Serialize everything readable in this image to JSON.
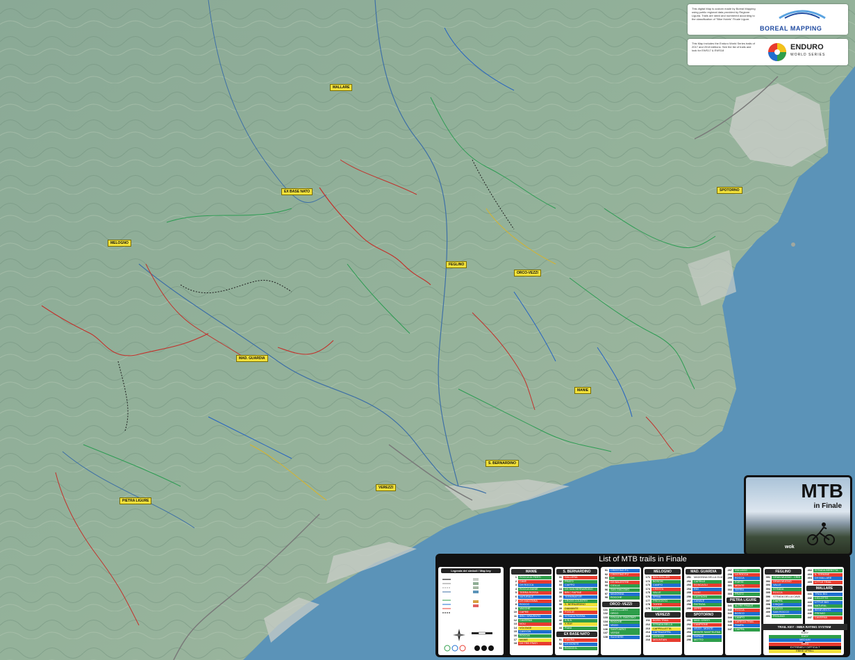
{
  "map": {
    "sea_color": "#5b93b8",
    "land_color": "#8fae95",
    "locations": [
      {
        "name": "MALLARE"
      },
      {
        "name": "EX BASE NATO"
      },
      {
        "name": "SPOTORNO"
      },
      {
        "name": "MELOGNO"
      },
      {
        "name": "FEGLINO"
      },
      {
        "name": "ORCO-VEZZI"
      },
      {
        "name": "MAD. GUARDIA"
      },
      {
        "name": "MANIE"
      },
      {
        "name": "S. BERNARDINO"
      },
      {
        "name": "VEREZZI"
      },
      {
        "name": "PIETRA LIGURE"
      }
    ]
  },
  "info_boreal": {
    "text": "This digital Map is custom made by Boreal Mapping using public regional data provided by Regione Liguria. Trails are rated and numbered according to the classification of \"Bike Hotels\" Finale Ligure.",
    "brand": "BOREAL MAPPING"
  },
  "info_ews": {
    "text": "This Map includes the Enduro World Series trails of 2017 and 2018 editions. See the list of trails and look for EWS17 & EWS18",
    "brand": "ENDURO",
    "brand_sub": "WORLD SERIES"
  },
  "photo": {
    "title": "MTB",
    "subtitle": "in Finale",
    "credit": "wok"
  },
  "list": {
    "title": "List of MTB trails in Finale",
    "legend_title": "Legenda dei simboli / Map key",
    "columns": [
      {
        "header": "MANIE",
        "rows": [
          {
            "n": "1",
            "name": "ROCCA DI PERTI",
            "c": "#2e9e4a"
          },
          {
            "n": "2",
            "name": "CAVE",
            "c": "#e83b2f"
          },
          {
            "n": "3",
            "name": "DH ROCCA",
            "c": "#1f6fd0"
          },
          {
            "n": "4",
            "name": "ROCCA MANIE",
            "c": "#2e9e4a"
          },
          {
            "n": "5",
            "name": "TERRA ROSSA",
            "c": "#e83b2f"
          },
          {
            "n": "6",
            "name": "NATURALE",
            "c": "#1f6fd0"
          },
          {
            "n": "7",
            "name": "DH MADONNA",
            "c": "#e83b2f"
          },
          {
            "n": "8",
            "name": "ROCCO",
            "c": "#1f6fd0"
          },
          {
            "n": "9",
            "name": "VACCHE",
            "c": "#2e9e4a"
          },
          {
            "n": "10",
            "name": "CAPRE",
            "c": "#e83b2f"
          },
          {
            "n": "11",
            "name": "BRIC SPAVENTO",
            "c": "#1f6fd0"
          },
          {
            "n": "12",
            "name": "CAVERNA",
            "c": "#2e9e4a"
          },
          {
            "n": "13",
            "name": "NOLI",
            "c": "#e83b2f"
          },
          {
            "n": "14",
            "name": "VOLTAGE",
            "c": "#f2e13a"
          },
          {
            "n": "15",
            "name": "CANYON",
            "c": "#1f6fd0"
          },
          {
            "n": "16",
            "name": "ROCCIA",
            "c": "#2e9e4a"
          },
          {
            "n": "17",
            "name": "MANIE",
            "c": "#f2e13a"
          },
          {
            "n": "18",
            "name": "DH TRE FRATI",
            "c": "#e83b2f"
          }
        ]
      },
      {
        "header": "S. BERNARDINO",
        "rows": [
          {
            "n": "31",
            "name": "GALLERIA",
            "c": "#e83b2f"
          },
          {
            "n": "32",
            "name": "PRATO",
            "c": "#2e9e4a"
          },
          {
            "n": "33",
            "name": "CIAPPO",
            "c": "#1f6fd0"
          },
          {
            "n": "34",
            "name": "DH SAN BERNARDINO",
            "c": "#2e9e4a"
          },
          {
            "n": "35",
            "name": "BRIC RAPINE",
            "c": "#e83b2f"
          },
          {
            "n": "36",
            "name": "TERMINATOR",
            "c": "#1f6fd0"
          },
          {
            "n": "37",
            "name": "CROSS COUNTRY",
            "c": "#2e9e4a"
          },
          {
            "n": "38",
            "name": "S. BERNARDINO",
            "c": "#f2e13a"
          },
          {
            "n": "39",
            "name": "DIAMANTE",
            "c": "#f2e13a"
          },
          {
            "n": "40",
            "name": "FOGLIE",
            "c": "#e83b2f"
          },
          {
            "n": "41",
            "name": "STRADA ROSSA",
            "c": "#1f6fd0"
          },
          {
            "n": "42",
            "name": "A.N.A.",
            "c": "#2e9e4a"
          },
          {
            "n": "43",
            "name": "X-RAY",
            "c": "#f2e13a"
          },
          {
            "n": "44",
            "name": "PIANI",
            "c": "#2e9e4a"
          }
        ],
        "sub": "EX BASE NATO",
        "subrows": [
          {
            "n": "51",
            "name": "CIAVRA",
            "c": "#e83b2f"
          },
          {
            "n": "52",
            "name": "DH MONTE",
            "c": "#1f6fd0"
          },
          {
            "n": "53",
            "name": "ROCCO IL",
            "c": "#2e9e4a"
          }
        ]
      },
      {
        "header": "",
        "rows": [
          {
            "n": "91",
            "name": "CRESTINO P.1",
            "c": "#1f6fd0"
          },
          {
            "n": "92",
            "name": "CRESTINO P.2",
            "c": "#e83b2f"
          },
          {
            "n": "93",
            "name": "DH",
            "c": "#2e9e4a"
          },
          {
            "n": "94",
            "name": "DH BALESTRE",
            "c": "#e83b2f"
          },
          {
            "n": "95",
            "name": "CIOLLA",
            "c": "#2e9e4a"
          },
          {
            "n": "96",
            "name": "SAN GIACOMO",
            "c": "#2e9e4a"
          },
          {
            "n": "97",
            "name": "MADONNA",
            "c": "#1f6fd0"
          },
          {
            "n": "98",
            "name": "ROCCHE",
            "c": "#2e9e4a"
          }
        ],
        "sub": "ORCO -VEZZI",
        "subrows": [
          {
            "n": "131",
            "name": "CASTELLARO",
            "c": "#2e9e4a"
          },
          {
            "n": "132",
            "name": "ORCO",
            "c": "#2e9e4a"
          },
          {
            "n": "133",
            "name": "COLLA S. GIACOMO",
            "c": "#2e9e4a"
          },
          {
            "n": "134",
            "name": "ROCCHE",
            "c": "#2e9e4a"
          },
          {
            "n": "135",
            "name": "VEZZI",
            "c": "#1f6fd0"
          },
          {
            "n": "136",
            "name": "SANTUARIO",
            "c": "#2e9e4a"
          },
          {
            "n": "137",
            "name": "VERDE",
            "c": "#2e9e4a"
          },
          {
            "n": "138",
            "name": "SUGHERE",
            "c": "#1f6fd0"
          }
        ]
      },
      {
        "header": "MELOGNO",
        "rows": [
          {
            "n": "171",
            "name": "BEN ROLLER",
            "c": "#e83b2f"
          },
          {
            "n": "172",
            "name": "BOSCHI",
            "c": "#2e9e4a"
          },
          {
            "n": "173",
            "name": "CAMPO",
            "c": "#1f6fd0"
          },
          {
            "n": "174",
            "name": "CRESTA",
            "c": "#e83b2f"
          },
          {
            "n": "175",
            "name": "VALLE",
            "c": "#2e9e4a"
          },
          {
            "n": "176",
            "name": "SPINA",
            "c": "#1f6fd0"
          },
          {
            "n": "177",
            "name": "PREVOSTO",
            "c": "#2e9e4a"
          },
          {
            "n": "178",
            "name": "TORRE",
            "c": "#e83b2f"
          },
          {
            "n": "179",
            "name": "POST",
            "c": "#2e9e4a"
          }
        ],
        "sub": "VEREZZI",
        "subrows": [
          {
            "n": "211",
            "name": "BORN TRAIL",
            "c": "#e83b2f"
          },
          {
            "n": "212",
            "name": "STRADA BELLA",
            "c": "#2e9e4a"
          },
          {
            "n": "213",
            "name": "CAPPELLETTA",
            "c": "#f2e13a"
          },
          {
            "n": "214",
            "name": "CAPRAZOPPA",
            "c": "#1f6fd0"
          },
          {
            "n": "215",
            "name": "VEREZZI",
            "c": "#2e9e4a"
          },
          {
            "n": "216",
            "name": "MOUNTAIN",
            "c": "#e83b2f"
          }
        ]
      },
      {
        "header": "MAD. GUARDIA",
        "rows": [
          {
            "n": "251",
            "name": "MADONNA DELLA GUARDIA",
            "c": "#ffffff"
          },
          {
            "n": "252",
            "name": "CAPRILE",
            "c": "#2e9e4a"
          },
          {
            "n": "253",
            "name": "RONCAGLI",
            "c": "#e83b2f"
          },
          {
            "n": "254",
            "name": "RIO",
            "c": "#1f6fd0"
          },
          {
            "n": "255",
            "name": "ULIVI",
            "c": "#e83b2f"
          },
          {
            "n": "256",
            "name": "CASTAGNI",
            "c": "#2e9e4a"
          },
          {
            "n": "257",
            "name": "CANALE",
            "c": "#1f6fd0"
          },
          {
            "n": "258",
            "name": "PATRIZIA",
            "c": "#2e9e4a"
          },
          {
            "n": "259",
            "name": "ZIPPE",
            "c": "#e83b2f"
          }
        ],
        "sub": "SPOTORNO",
        "subrows": [
          {
            "n": "291",
            "name": "MAD. CRISTI",
            "c": "#2e9e4a"
          },
          {
            "n": "292",
            "name": "CAMPIONE",
            "c": "#e83b2f"
          },
          {
            "n": "293",
            "name": "VEZZI - MONTE",
            "c": "#1f6fd0"
          },
          {
            "n": "294",
            "name": "MONTE SANT'ELENA",
            "c": "#2e9e4a"
          },
          {
            "n": "295",
            "name": "PAPALE",
            "c": "#1f6fd0"
          },
          {
            "n": "296",
            "name": "MOTTO",
            "c": "#2e9e4a"
          }
        ]
      },
      {
        "header": "",
        "rows": [
          {
            "n": "297",
            "name": "VIA LAGO",
            "c": "#2e9e4a"
          },
          {
            "n": "298",
            "name": "LA ROCCA",
            "c": "#e83b2f"
          },
          {
            "n": "299",
            "name": "ROCCA",
            "c": "#1f6fd0"
          },
          {
            "n": "300",
            "name": "FORTE",
            "c": "#2e9e4a"
          },
          {
            "n": "301",
            "name": "MONTE",
            "c": "#e83b2f"
          },
          {
            "n": "302",
            "name": "SERRA",
            "c": "#1f6fd0"
          },
          {
            "n": "303",
            "name": "PRATO",
            "c": "#2e9e4a"
          }
        ],
        "sub": "PIETRA LIGURE",
        "subrows": [
          {
            "n": "341",
            "name": "ALTRE FINALE",
            "c": "#2e9e4a"
          },
          {
            "n": "342",
            "name": "ROCCA",
            "c": "#e83b2f"
          },
          {
            "n": "343",
            "name": "BOSCO",
            "c": "#1f6fd0"
          },
          {
            "n": "344",
            "name": "CAMPO",
            "c": "#2e9e4a"
          },
          {
            "n": "345",
            "name": "CAREGA TRAIL",
            "c": "#e83b2f"
          },
          {
            "n": "346",
            "name": "PAMPA",
            "c": "#1f6fd0"
          },
          {
            "n": "347",
            "name": "CIAPPA",
            "c": "#2e9e4a"
          }
        ]
      },
      {
        "header": "FEGLINO",
        "rows": [
          {
            "n": "391",
            "name": "GRAN MUGNO - CRIS",
            "c": "#2e9e4a"
          },
          {
            "n": "392",
            "name": "GRAN MUGNO",
            "c": "#e83b2f"
          },
          {
            "n": "393",
            "name": "VALLE",
            "c": "#1f6fd0"
          },
          {
            "n": "394",
            "name": "STRADA",
            "c": "#2e9e4a"
          },
          {
            "n": "395",
            "name": "ROCCA",
            "c": "#e83b2f"
          },
          {
            "n": "396",
            "name": "STRADA DELLA CAVA",
            "c": "#ffffff"
          },
          {
            "n": "397",
            "name": "CIAPPA",
            "c": "#2e9e4a"
          },
          {
            "n": "398",
            "name": "CINQUE",
            "c": "#1f6fd0"
          },
          {
            "n": "399",
            "name": "CUCCO",
            "c": "#2e9e4a"
          },
          {
            "n": "400",
            "name": "SAN ROCCO",
            "c": "#1f6fd0"
          },
          {
            "n": "401",
            "name": "FEGLINO",
            "c": "#2e9e4a"
          }
        ]
      },
      {
        "header": "",
        "rows": [
          {
            "n": "402",
            "name": "STRADA BERETTA",
            "c": "#2e9e4a"
          },
          {
            "n": "403",
            "name": "IL TERMINE",
            "c": "#e83b2f"
          },
          {
            "n": "404",
            "name": "DH MALLARE",
            "c": "#1f6fd0"
          },
          {
            "n": "405",
            "name": "LITTLE TRAIL",
            "c": "#e83b2f"
          }
        ],
        "sub": "MALLARE",
        "subrows": [
          {
            "n": "441",
            "name": "TRAIL BIG",
            "c": "#1f6fd0"
          },
          {
            "n": "442",
            "name": "CICLOTTO",
            "c": "#2e9e4a"
          },
          {
            "n": "443",
            "name": "LITTLE BIG",
            "c": "#1f6fd0"
          },
          {
            "n": "444",
            "name": "NATURAL",
            "c": "#2e9e4a"
          },
          {
            "n": "445",
            "name": "BENEVENTO",
            "c": "#1f6fd0"
          },
          {
            "n": "446",
            "name": "PREMIO",
            "c": "#2e9e4a"
          },
          {
            "n": "447",
            "name": "CAVERNA",
            "c": "#e83b2f"
          }
        ]
      }
    ],
    "imba_title": "TRAIL KEY - IMBA RATING SYSTEM",
    "imba_rows": [
      {
        "n": "1",
        "label": "EASY",
        "c": "#ffffff"
      },
      {
        "n": "2",
        "label": "EASY",
        "c": "#2e9e4a"
      },
      {
        "n": "3",
        "label": "MEDIUM",
        "c": "#1f6fd0"
      },
      {
        "n": "4",
        "label": "HARD",
        "c": "#e83b2f"
      },
      {
        "n": "5",
        "label": "EXTREMELY DIFFICULT",
        "c": "#111111"
      },
      {
        "n": "6",
        "label": "EBIKE UPHILL",
        "c": "#f2e13a"
      }
    ]
  }
}
